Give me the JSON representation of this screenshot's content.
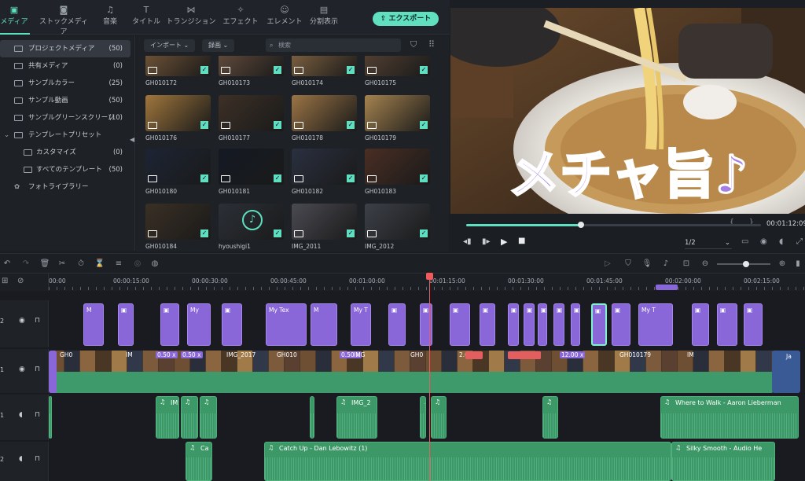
{
  "top_tabs": [
    {
      "label": "メディア",
      "icon": "media-icon",
      "active": true
    },
    {
      "label": "ストックメディア",
      "icon": "stock-media-icon"
    },
    {
      "label": "音楽",
      "icon": "music-icon"
    },
    {
      "label": "タイトル",
      "icon": "title-icon"
    },
    {
      "label": "トランジション",
      "icon": "transition-icon"
    },
    {
      "label": "エフェクト",
      "icon": "effect-icon"
    },
    {
      "label": "エレメント",
      "icon": "element-icon"
    },
    {
      "label": "分割表示",
      "icon": "split-icon"
    }
  ],
  "export_label": "エクスポート",
  "sidebar": {
    "items": [
      {
        "label": "プロジェクトメディア",
        "count": "(50)",
        "selected": true
      },
      {
        "label": "共有メディア",
        "count": "(0)"
      },
      {
        "label": "サンプルカラー",
        "count": "(25)"
      },
      {
        "label": "サンプル動画",
        "count": "(50)"
      },
      {
        "label": "サンプルグリーンスクリーン",
        "count": "(10)"
      },
      {
        "label": "テンプレートプリセット",
        "count": ""
      },
      {
        "label": "カスタマイズ",
        "count": "(0)"
      },
      {
        "label": "すべてのテンプレート",
        "count": "(50)"
      },
      {
        "label": "フォトライブラリー",
        "count": ""
      }
    ]
  },
  "media_toolbar": {
    "import_label": "インポート",
    "record_label": "録画",
    "search_placeholder": "検索"
  },
  "media_grid": [
    {
      "name": "GH010172",
      "color": "#7a5a3a"
    },
    {
      "name": "GH010173",
      "color": "#6b5140"
    },
    {
      "name": "GH010174",
      "color": "#8a6a45"
    },
    {
      "name": "GH010175",
      "color": "#5a4535"
    },
    {
      "name": "GH010176",
      "color": "#a0763c"
    },
    {
      "name": "GH010177",
      "color": "#3d3026"
    },
    {
      "name": "GH010178",
      "color": "#9b7445"
    },
    {
      "name": "GH010179",
      "color": "#a5834f"
    },
    {
      "name": "GH010180",
      "color": "#1c2434"
    },
    {
      "name": "GH010181",
      "color": "#141923"
    },
    {
      "name": "GH010182",
      "color": "#2a3040"
    },
    {
      "name": "GH010183",
      "color": "#4a2e24"
    },
    {
      "name": "GH010184",
      "color": "#3a3024"
    },
    {
      "name": "hyoushigi1",
      "color": "#2b3037"
    },
    {
      "name": "IMG_2011",
      "color": "#4a4a52"
    },
    {
      "name": "IMG_2012",
      "color": "#3c4048"
    }
  ],
  "preview": {
    "caption": "メチャ旨♪",
    "timecode": "00:01:12:09",
    "zoom": "1/2",
    "progress": 0.39
  },
  "ruler_labels": [
    "00:00",
    "00:00:15:00",
    "00:00:30:00",
    "00:00:45:00",
    "00:01:00:00",
    "00:01:15:00",
    "00:01:30:00",
    "00:01:45:00",
    "00:02:00:00",
    "00:02:15:00"
  ],
  "tracks": {
    "title_track_label": "2",
    "video_track_label": "1",
    "audio1_label": "1",
    "audio2_label": "2"
  },
  "title_clip_labels": [
    "M",
    "My Tex",
    "My",
    "M",
    "My T",
    "M"
  ],
  "video_clip_labels": [
    "GH0",
    "IM",
    "0.50 x",
    "0.50 x",
    "IMG_2017",
    "GH010",
    "0.50 x",
    "IMG",
    "GH0",
    "2.0",
    "12.00 x",
    "GH010179",
    "IM",
    "Ja"
  ],
  "audio1_clips": [
    "IM",
    "IMG_2",
    "Where to Walk - Aaron Lieberman"
  ],
  "audio2_clips": [
    "Ca",
    "Catch Up - Dan Lebowitz (1)",
    "Silky Smooth - Audio He"
  ]
}
